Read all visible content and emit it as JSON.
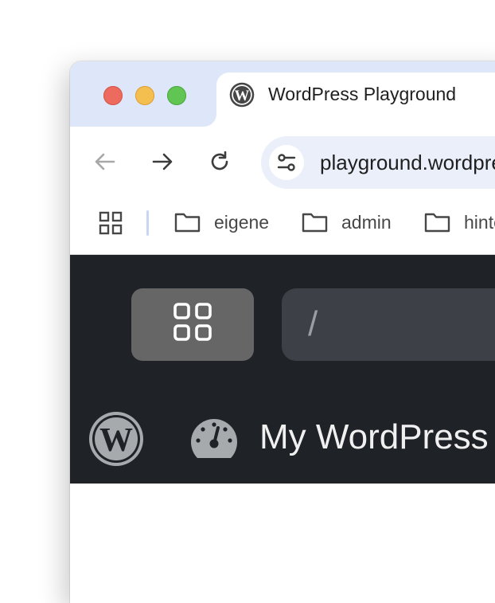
{
  "browser": {
    "tab": {
      "title": "WordPress Playground",
      "favicon": "wordpress-icon"
    },
    "toolbar": {
      "back_icon": "arrow-left-icon",
      "forward_icon": "arrow-right-icon",
      "reload_icon": "reload-icon",
      "site_info_icon": "tune-icon",
      "url": "playground.wordpress.net"
    },
    "bookmarks": {
      "apps_icon": "apps-grid-icon",
      "items": [
        {
          "label": "eigene",
          "icon": "folder-icon"
        },
        {
          "label": "admin",
          "icon": "folder-icon"
        },
        {
          "label": "hinter",
          "icon": "folder-icon"
        }
      ]
    }
  },
  "playground": {
    "site_button_icon": "sites-grid-icon",
    "path": "/",
    "admin_bar": {
      "logo": "wordpress-logo-icon",
      "dashboard_icon": "dashboard-gauge-icon",
      "site_title": "My WordPress Website"
    }
  },
  "colors": {
    "tabstrip_bg": "#dde7f9",
    "omnibox_bg": "#eaeffa",
    "wp_bar_bg": "#1f2226",
    "site_button_bg": "#666666",
    "path_field_bg": "#3d4047"
  }
}
